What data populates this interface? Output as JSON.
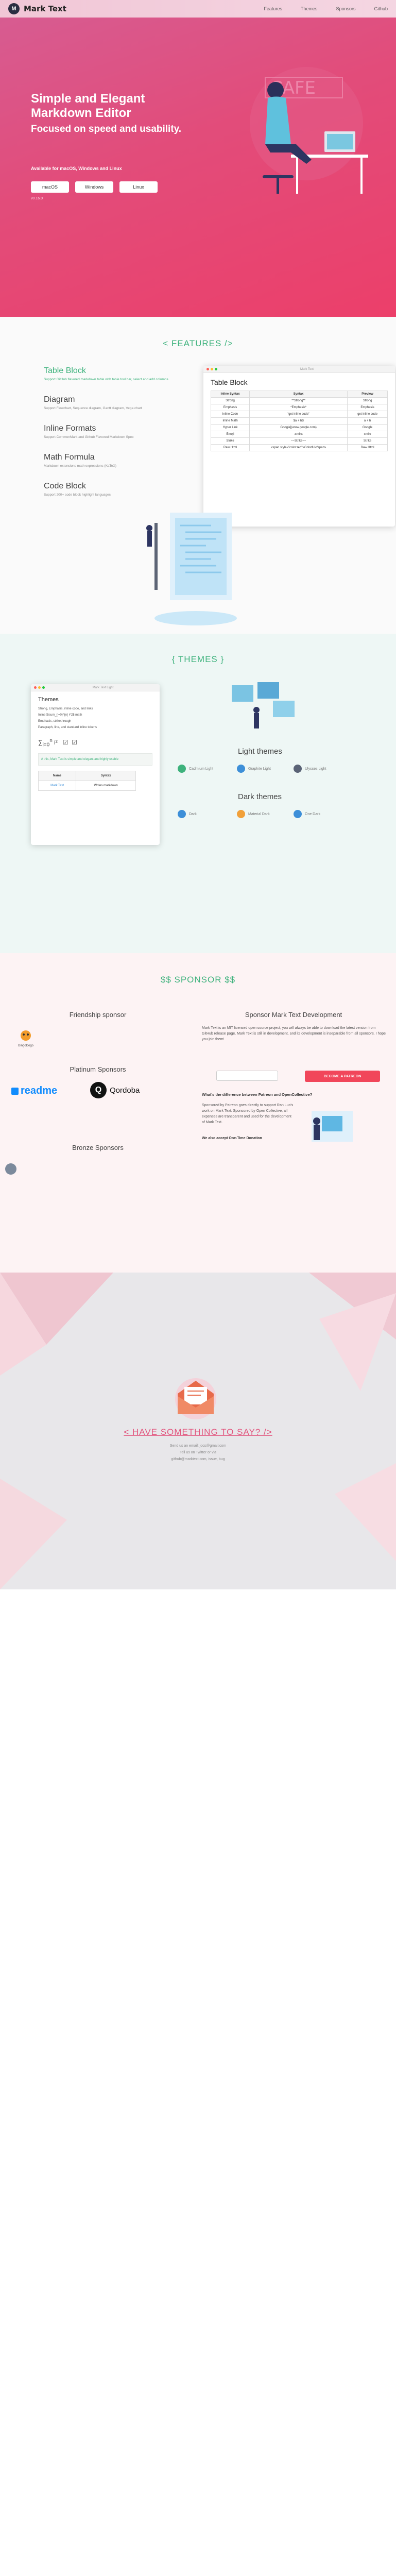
{
  "nav": {
    "brand": "Mark Text",
    "links": [
      "Features",
      "Themes",
      "Sponsors",
      "Github"
    ]
  },
  "hero": {
    "headline": "Simple and Elegant Markdown Editor",
    "tagline": "Focused on speed and usability.",
    "available": "Available for macOS, Windows and Linux",
    "buttons": [
      "macOS",
      "Windows",
      "Linux"
    ],
    "version": "v0.16.0"
  },
  "features": {
    "title": "< FEATURES />",
    "items": [
      {
        "title": "Table Block",
        "desc": "Support GitHub flavored markdown table with table tool bar, select and add columns"
      },
      {
        "title": "Diagram",
        "desc": "Support Flowchart, Sequence diagram, Gantt diagram, Vega chart"
      },
      {
        "title": "Inline Formats",
        "desc": "Support CommonMark and Github Flavored Markdown Spec"
      },
      {
        "title": "Math Formula",
        "desc": "Markdown extensions math expressions (KaTeX)"
      },
      {
        "title": "Code Block",
        "desc": "Support 200+ code block highlight languages"
      }
    ],
    "window_title": "Mark Text",
    "table_heading": "Table Block",
    "table_headers": [
      "Inline Syntax",
      "Syntax",
      "Preview"
    ],
    "table_rows": [
      [
        "Strong",
        "**Strong**",
        "Strong"
      ],
      [
        "Emphasis",
        "*Emphasis*",
        "Emphasis"
      ],
      [
        "Inline Code",
        "`get inline code`",
        "get inline code"
      ],
      [
        "Inline Math",
        "$a + b$",
        "a + b"
      ],
      [
        "Hyper Link",
        "Google](www.google.com)",
        "Google"
      ],
      [
        "Emoji",
        ":smile:",
        "smile"
      ],
      [
        "Strike",
        "~~Strike~~",
        "Strike"
      ],
      [
        "Raw Html",
        "<span style=\"color:red\">Colorful</span>",
        "Raw Html"
      ]
    ]
  },
  "themes": {
    "title": "{ THEMES }",
    "window_title": "Mark Text Light",
    "card_heading": "Themes",
    "card_lines": [
      "Strong, Emphasis, inline code, and links",
      "Inline $\\sum_{i=0}^{n} i^2$ math",
      "Emphasis, strikethrough",
      "Paragraph, line, and standard inline tokens"
    ],
    "card_code": "// this, Mark Text is simple and elegant and highly usable",
    "card_table_headers": [
      "Name",
      "Syntax"
    ],
    "card_table_rows": [
      [
        "Mark Text",
        "Writes markdown"
      ]
    ],
    "light_label": "Light themes",
    "light_themes": [
      "Cadmium Light",
      "Graphite Light",
      "Ulysses Light"
    ],
    "dark_label": "Dark themes",
    "dark_themes": [
      "Dark",
      "Material Dark",
      "One Dark"
    ]
  },
  "sponsor": {
    "title": "$$ SPONSOR $$",
    "friendship": "Friendship sponsor",
    "friendship_name": "DingoDogo",
    "platinum": "Platinum Sponsors",
    "readme": "readme",
    "qordoba": "Qordoba",
    "bronze": "Bronze Sponsors",
    "develop_title": "Sponsor Mark Text Development",
    "develop_text": "Mark Text is an MIT licensed open source project, you will always be able to download the latest version from GitHub release page. Mark Text is still in development, and its development is inseparable from all sponsors. I hope you join them!",
    "become": "BECOME A PATREON",
    "diff_title": "What's the difference between Patreon and OpenCollective?",
    "diff_text": "Sponsored by Patreon goes directly to support Ran Luo's work on Mark Text. Sponsored by Open Collective, all expenses are transparent and used for the development of Mark Text.",
    "accept": "We also accept One-Time Donation"
  },
  "contact": {
    "title": "< HAVE SOMETHING TO SAY? />",
    "lines": [
      "Send us an email: jocs@gmail.com",
      "Tell us on Twitter or via",
      "github@marktext.com, issue, bug"
    ]
  },
  "colors": {
    "hero_start": "#d65d93",
    "hero_end": "#ec3f6a",
    "green": "#3db27c",
    "patreon": "#f1465a"
  }
}
